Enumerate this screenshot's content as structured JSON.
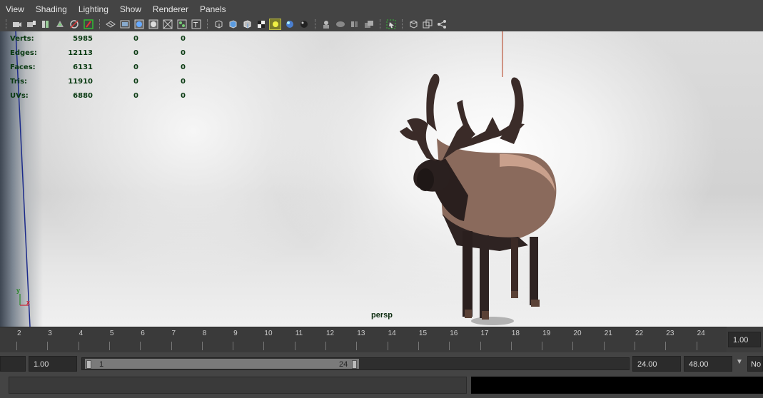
{
  "menu": [
    "View",
    "Shading",
    "Lighting",
    "Show",
    "Renderer",
    "Panels"
  ],
  "toolbar_icons": [
    "select-camera-icon",
    "camera-attributes-icon",
    "bookmark-icon",
    "image-plane-icon",
    "2d-pan-zoom-icon",
    "grease-pencil-icon",
    "grid-icon",
    "film-gate-icon",
    "resolution-gate-icon",
    "gate-mask-icon",
    "field-chart-icon",
    "safe-action-icon",
    "safe-title-icon",
    "wireframe-icon",
    "smooth-shade-icon",
    "default-material-icon",
    "textured-icon",
    "use-lights-icon",
    "shadows-icon",
    "screen-ambient-occlusion-icon",
    "motion-blur-icon",
    "multisample-aa-icon",
    "depth-of-field-icon",
    "hud-icon",
    "isolate-select-icon",
    "xray-icon",
    "xray-joints-icon",
    "xray-components-icon"
  ],
  "hud": [
    {
      "label": "Verts:",
      "v1": "5985",
      "v2": "0",
      "v3": "0"
    },
    {
      "label": "Edges:",
      "v1": "12113",
      "v2": "0",
      "v3": "0"
    },
    {
      "label": "Faces:",
      "v1": "6131",
      "v2": "0",
      "v3": "0"
    },
    {
      "label": "Tris:",
      "v1": "11910",
      "v2": "0",
      "v3": "0"
    },
    {
      "label": "UVs:",
      "v1": "6880",
      "v2": "0",
      "v3": "0"
    }
  ],
  "camera_label": "persp",
  "axis": {
    "y": "y",
    "x": "x"
  },
  "timeline": {
    "ticks": [
      "2",
      "3",
      "4",
      "5",
      "6",
      "7",
      "8",
      "9",
      "10",
      "11",
      "12",
      "13",
      "14",
      "15",
      "16",
      "17",
      "18",
      "19",
      "20",
      "21",
      "22",
      "23",
      "24"
    ],
    "current_frame": "1.00"
  },
  "range": {
    "start_time": "",
    "playback_start": "1.00",
    "slider_start": "1",
    "slider_end": "24",
    "playback_end": "24.00",
    "end_time": "48.00",
    "character_set": "No"
  },
  "colors": {
    "hud_text": "#0a3a12",
    "panel_bg": "#444444",
    "slider_fill": "#7a7a7a"
  }
}
